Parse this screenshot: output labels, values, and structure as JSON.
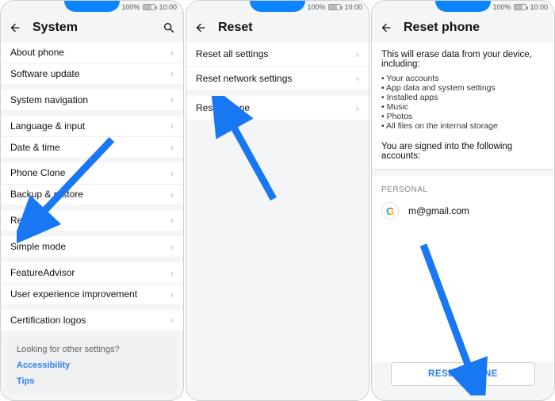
{
  "statusbar": {
    "battery": "100%",
    "time": "10:00"
  },
  "screen1": {
    "title": "System",
    "items": [
      {
        "label": "About phone"
      },
      {
        "label": "Software update"
      },
      {
        "label": "System navigation"
      },
      {
        "label": "Language & input"
      },
      {
        "label": "Date & time"
      },
      {
        "label": "Phone Clone"
      },
      {
        "label": "Backup & restore"
      },
      {
        "label": "Reset"
      },
      {
        "label": "Simple mode"
      },
      {
        "label": "FeatureAdvisor"
      },
      {
        "label": "User experience improvement"
      },
      {
        "label": "Certification logos"
      }
    ],
    "footer": {
      "looking": "Looking for other settings?",
      "link1": "Accessibility",
      "link2": "Tips"
    }
  },
  "screen2": {
    "title": "Reset",
    "items": [
      {
        "label": "Reset all settings"
      },
      {
        "label": "Reset network settings"
      },
      {
        "label": "Reset phone"
      }
    ]
  },
  "screen3": {
    "title": "Reset phone",
    "desc": "This will erase data from your device, including:",
    "bullets": [
      "Your accounts",
      "App data and system settings",
      "Installed apps",
      "Music",
      "Photos",
      "All files on the internal storage"
    ],
    "signed": "You are signed into the following accounts:",
    "section": "PERSONAL",
    "account_email": "m@gmail.com",
    "button": "RESET PHONE"
  }
}
